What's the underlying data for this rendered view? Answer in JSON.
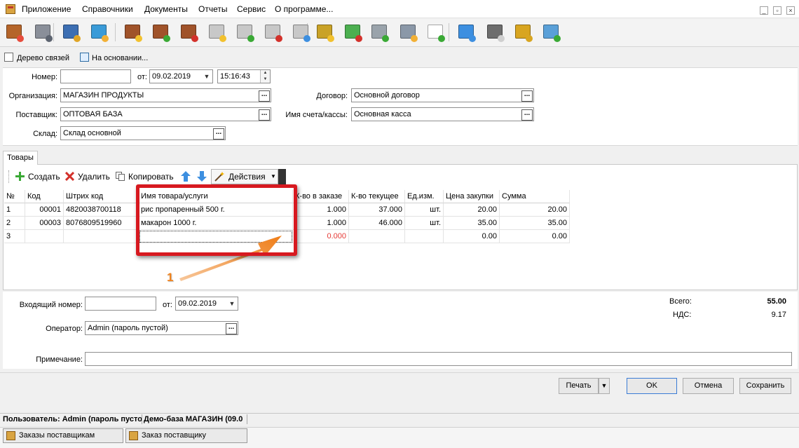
{
  "menu": {
    "items": [
      "Приложение",
      "Справочники",
      "Документы",
      "Отчеты",
      "Сервис",
      "О программе..."
    ]
  },
  "window_controls": [
    "_",
    "▫",
    "×"
  ],
  "toolbar_icons": [
    "exit-icon",
    "lock-icon",
    "books-icon",
    "users-icon",
    "document-star-icon",
    "document-add-icon",
    "document-remove-icon",
    "basket-star-icon",
    "basket-add-icon",
    "basket-remove-icon",
    "basket-arrow-icon",
    "coins-star-icon",
    "cash-icon",
    "truck-icon",
    "calculator-icon",
    "spellcheck-icon",
    "export-arrow-icon",
    "printer-icon",
    "scales-icon",
    "upload-box-icon"
  ],
  "links": {
    "tree": "Дерево связей",
    "based_on": "На основании..."
  },
  "header_form": {
    "number_label": "Номер:",
    "number_value": "",
    "from_label": "от:",
    "date_value": "09.02.2019",
    "time_value": "15:16:43",
    "org_label": "Организация:",
    "org_value": "МАГАЗИН ПРОДУКТЫ",
    "supplier_label": "Поставщик:",
    "supplier_value": "ОПТОВАЯ БАЗА",
    "warehouse_label": "Склад:",
    "warehouse_value": "Склад основной",
    "contract_label": "Договор:",
    "contract_value": "Основной договор",
    "account_label": "Имя счета/кассы:",
    "account_value": "Основная касса",
    "dots": "..."
  },
  "tabs": {
    "goods": "Товары"
  },
  "grid_toolbar": {
    "create": "Создать",
    "delete": "Удалить",
    "copy": "Копировать",
    "actions": "Действия"
  },
  "grid": {
    "columns": [
      "№",
      "Код",
      "Штрих код",
      "Имя товара/услуги",
      "К-во в заказе",
      "К-во текущее",
      "Ед.изм.",
      "Цена закупки",
      "Сумма"
    ],
    "rows": [
      [
        "1",
        "00001",
        "4820038700118",
        "рис пропаренный 500 г.",
        "1.000",
        "37.000",
        "шт.",
        "20.00",
        "20.00"
      ],
      [
        "2",
        "00003",
        "8076809519960",
        "макарон 1000 г.",
        "1.000",
        "46.000",
        "шт.",
        "35.00",
        "35.00"
      ],
      [
        "3",
        "",
        "",
        "",
        "0.000",
        "",
        "",
        "0.00",
        "0.00"
      ]
    ]
  },
  "annotation": {
    "number": "1"
  },
  "bottom_form": {
    "incoming_label": "Входящий номер:",
    "incoming_value": "",
    "from_label": "от:",
    "incoming_date": "09.02.2019",
    "operator_label": "Оператор:",
    "operator_value": "Admin (пароль пустой)",
    "note_label": "Примечание:",
    "note_value": "",
    "total_label": "Всего:",
    "total_value": "55.00",
    "vat_label": "НДС:",
    "vat_value": "9.17"
  },
  "buttons": {
    "print": "Печать",
    "ok": "OK",
    "cancel": "Отмена",
    "save": "Сохранить"
  },
  "status": {
    "user": "Пользователь: Admin (пароль пусто",
    "db": "Демо-база МАГАЗИН (09.0"
  },
  "tasks": [
    "Заказы поставщикам",
    "Заказ поставщику"
  ],
  "colors": {
    "highlight": "#d71920",
    "arrow": "#f0831e",
    "negative": "#e53935"
  }
}
